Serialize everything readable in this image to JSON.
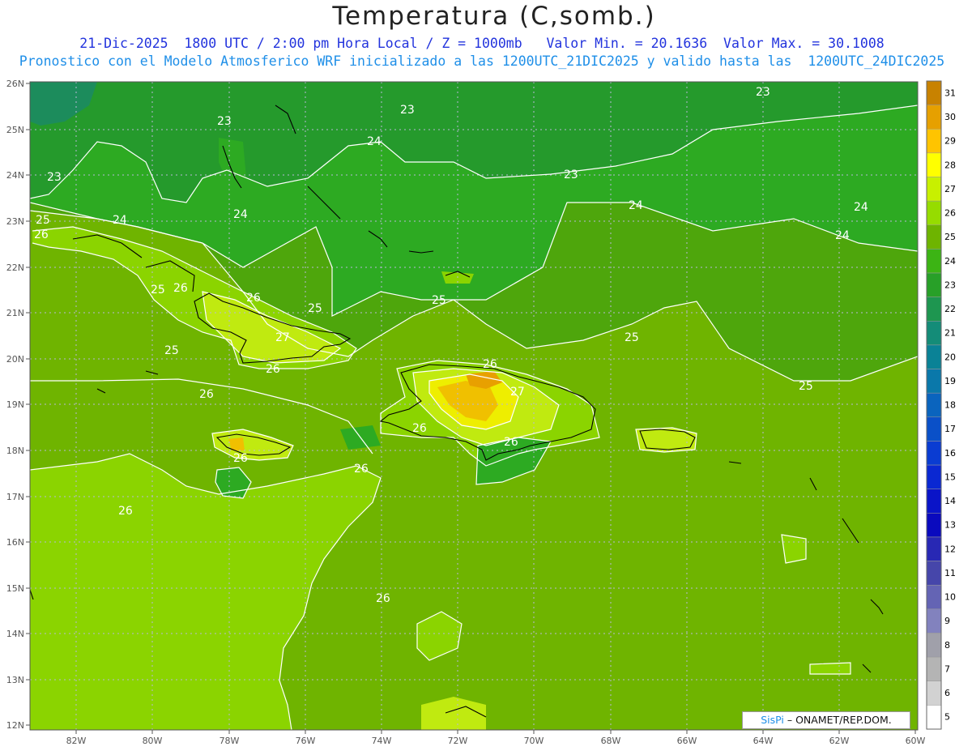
{
  "title": "Temperatura (C,somb.)",
  "subtitle_line1": "21-Dic-2025  1800 UTC / 2:00 pm Hora Local / Z = 1000mb   Valor Min. = 20.1636  Valor Max. = 30.1008",
  "subtitle_line2": "Pronostico con el Modelo Atmosferico WRF inicializado a las 1200UTC_21DIC2025 y valido hasta las  1200UTC_24DIC2025",
  "credit_sis": "SisPi",
  "credit_org": "– ONAMET/REP.DOM.",
  "lat_labels": [
    "26N",
    "25N",
    "24N",
    "23N",
    "22N",
    "21N",
    "20N",
    "19N",
    "18N",
    "17N",
    "16N",
    "15N",
    "14N",
    "13N",
    "12N"
  ],
  "lon_labels": [
    "82W",
    "80W",
    "78W",
    "76W",
    "74W",
    "72W",
    "70W",
    "68W",
    "66W",
    "64W",
    "62W",
    "60W"
  ],
  "contour_labels": [
    "23",
    "23",
    "23",
    "23",
    "23",
    "24",
    "24",
    "24",
    "24",
    "24",
    "24",
    "25",
    "25",
    "25",
    "25",
    "25",
    "25",
    "25",
    "26",
    "26",
    "26",
    "26",
    "26",
    "26",
    "26",
    "26",
    "26",
    "26",
    "27",
    "27"
  ],
  "colorbar": {
    "levels": [
      "31",
      "30",
      "29",
      "28",
      "27",
      "26",
      "25",
      "24",
      "23",
      "22",
      "21",
      "20",
      "19",
      "18",
      "17",
      "16",
      "15",
      "14",
      "13",
      "12",
      "11",
      "10",
      "9",
      "8",
      "7",
      "6",
      "5"
    ],
    "colors": [
      "#c88200",
      "#e6a000",
      "#ffc400",
      "#ffff00",
      "#c8f000",
      "#96dc00",
      "#6eb400",
      "#3cb414",
      "#28a028",
      "#1e9650",
      "#148c78",
      "#0a8296",
      "#0a78aa",
      "#0a64be",
      "#0a50c8",
      "#0a3cd2",
      "#0a28d2",
      "#0a14c8",
      "#0a0abe",
      "#2828b4",
      "#4646aa",
      "#6464b4",
      "#8282be",
      "#a0a0aa",
      "#b4b4b4",
      "#d2d2d2",
      "#ffffff"
    ]
  },
  "colors": {
    "c23": "#259a2c",
    "c24": "#2daa22",
    "c25": "#4ea60c",
    "c26": "#6fb400",
    "c265": "#8bd400",
    "c27": "#c0ea10",
    "c28": "#eeee00",
    "c29": "#f0c000",
    "c30": "#e8a000",
    "c22": "#1c8c5c"
  }
}
